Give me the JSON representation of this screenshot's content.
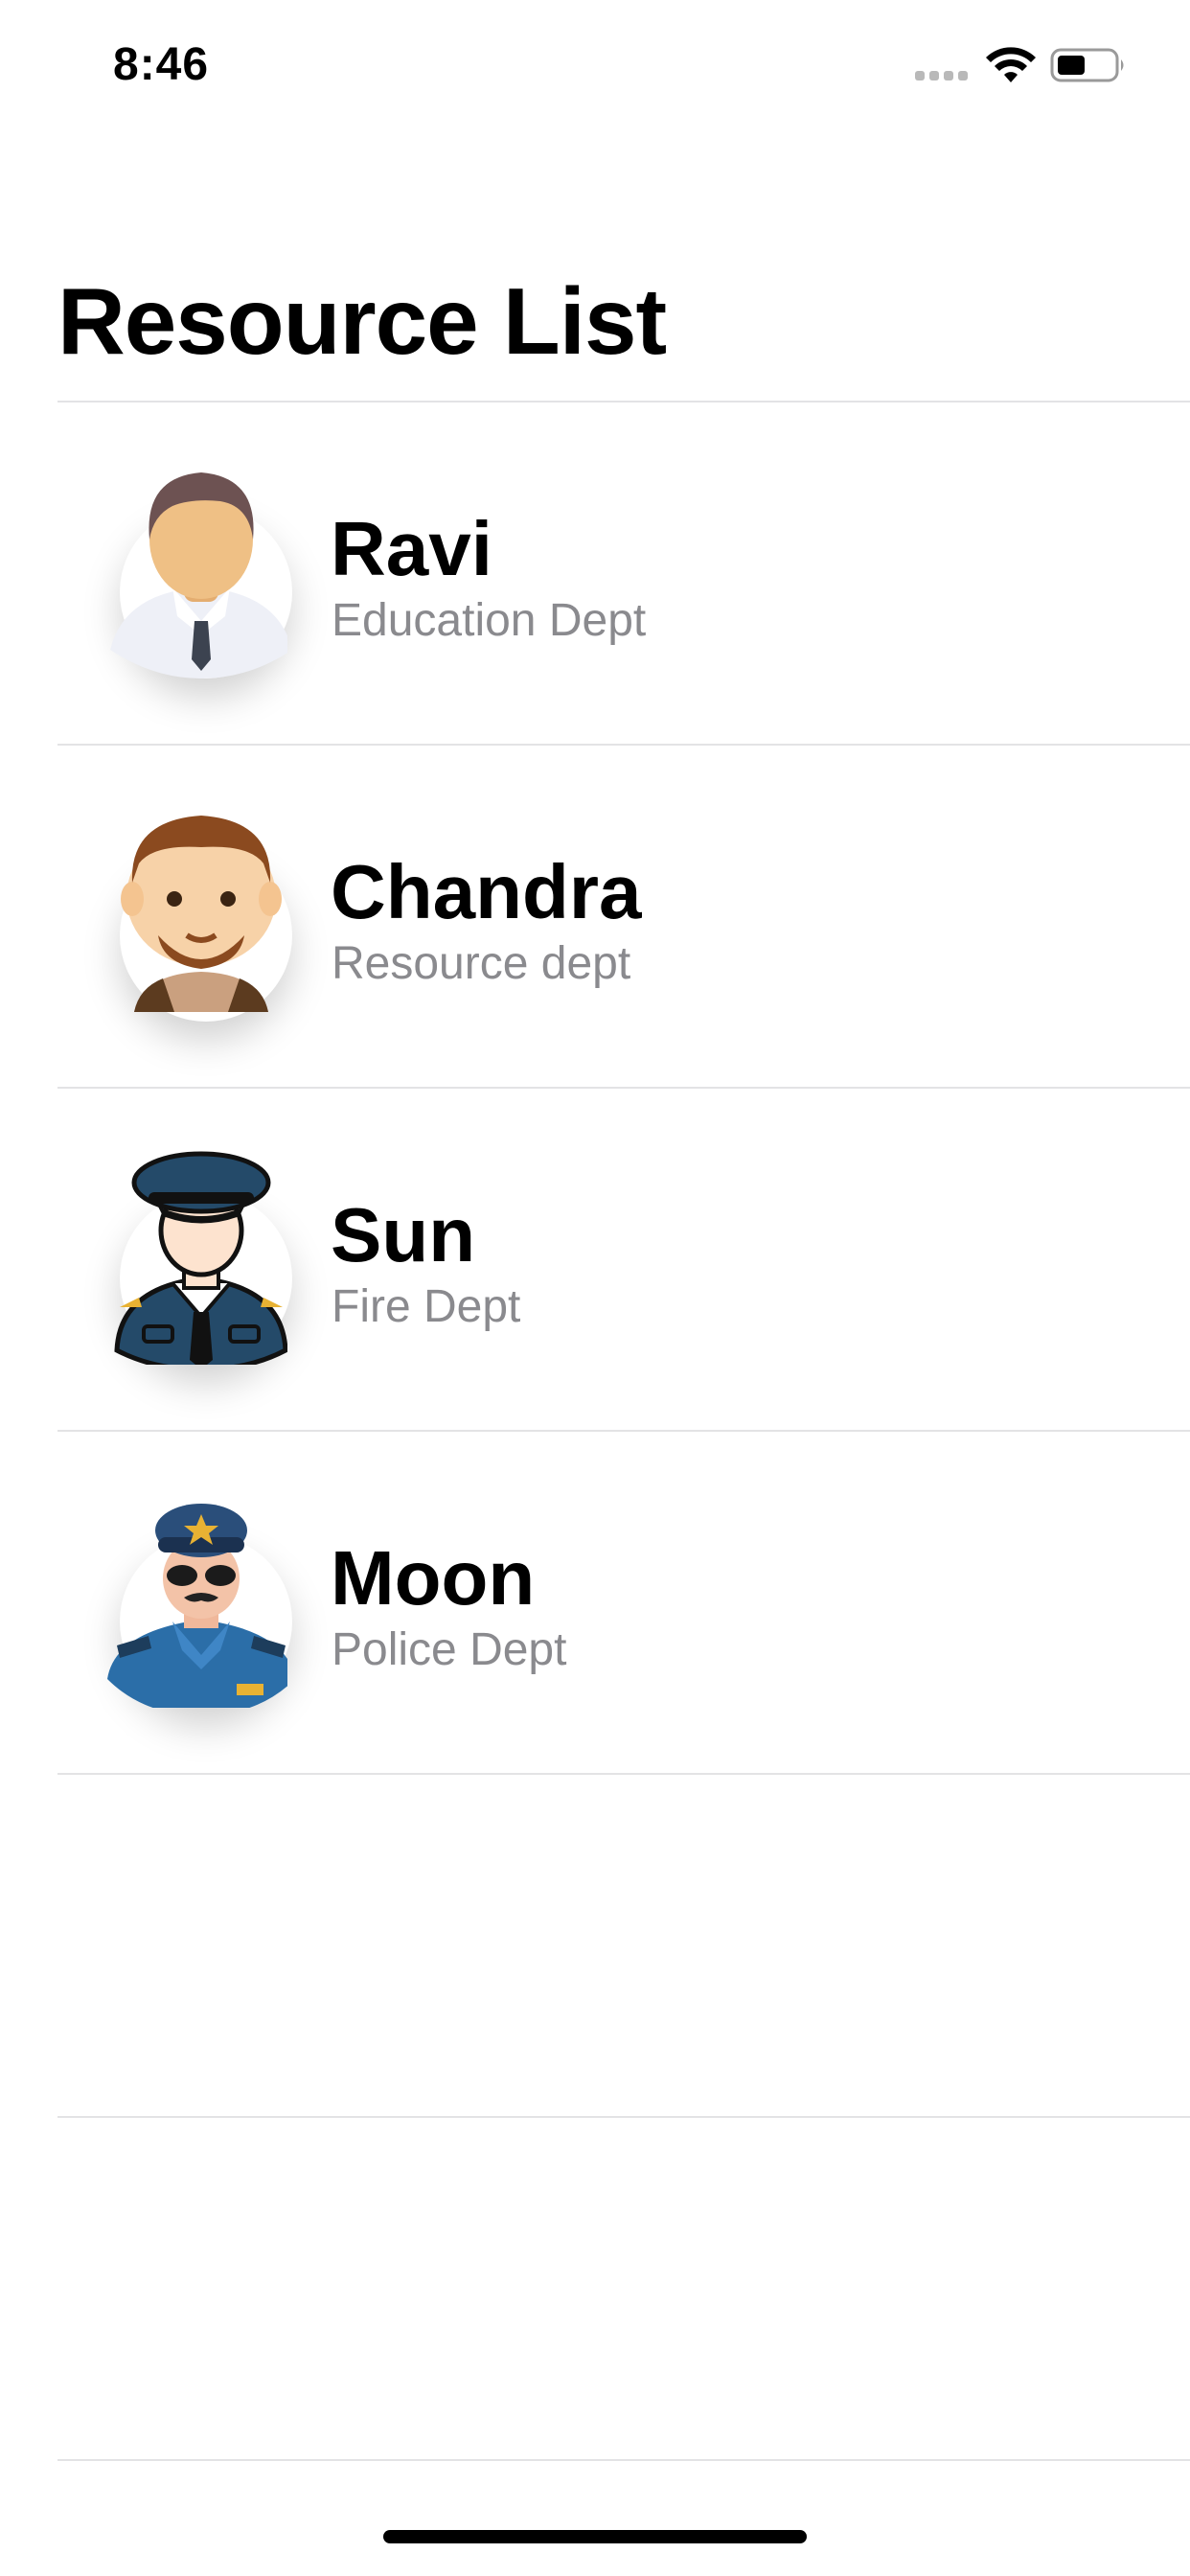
{
  "status_bar": {
    "time": "8:46",
    "signal_icon": "cellular-signal-icon",
    "wifi_icon": "wifi-icon",
    "battery_icon": "battery-icon",
    "battery_level": 0.45
  },
  "page": {
    "title": "Resource List"
  },
  "resources": [
    {
      "name": "Ravi",
      "department": "Education Dept",
      "avatar_icon": "businessman-avatar-icon"
    },
    {
      "name": "Chandra",
      "department": "Resource dept",
      "avatar_icon": "bearded-man-avatar-icon"
    },
    {
      "name": "Sun",
      "department": "Fire Dept",
      "avatar_icon": "fire-officer-avatar-icon"
    },
    {
      "name": "Moon",
      "department": "Police Dept",
      "avatar_icon": "police-officer-avatar-icon"
    }
  ],
  "colors": {
    "text_primary": "#000000",
    "text_secondary": "#8a8a8e",
    "divider": "#e3e3e5",
    "background": "#ffffff"
  }
}
